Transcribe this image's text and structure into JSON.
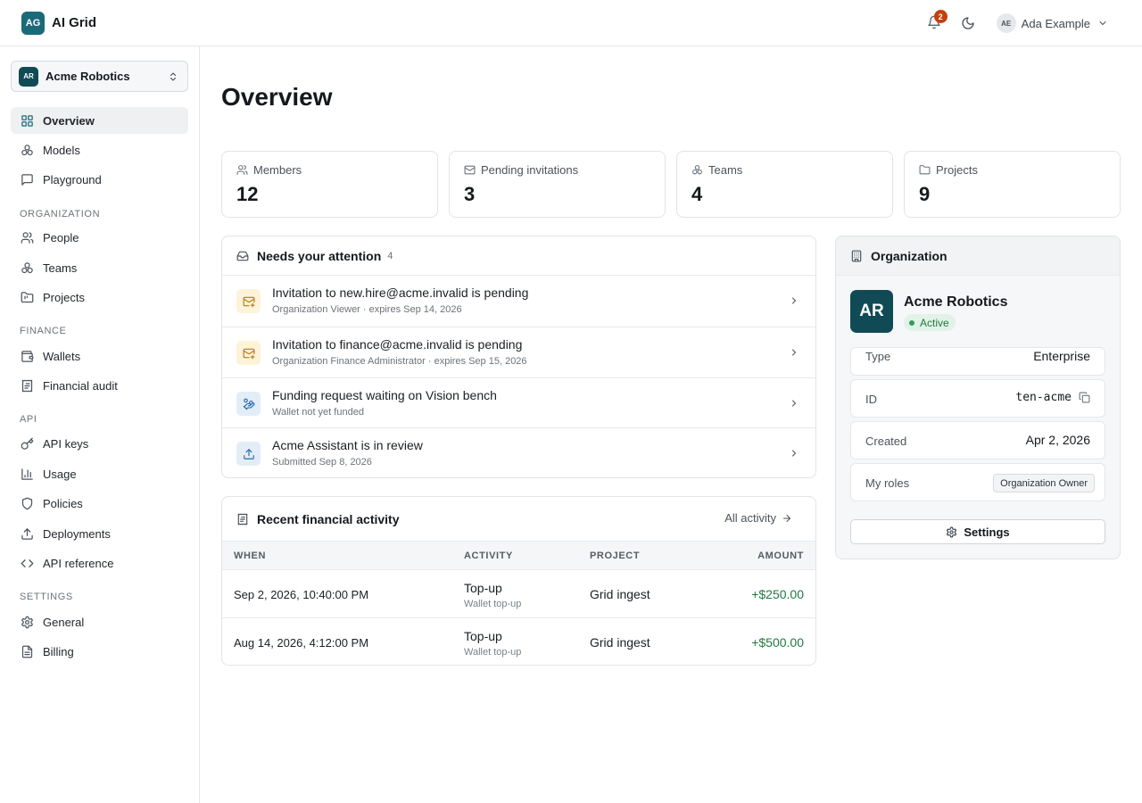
{
  "app": {
    "logo": "AG",
    "name": "AI Grid"
  },
  "header": {
    "notifications_count": "2",
    "user_initials": "AE",
    "user_name": "Ada Example"
  },
  "sidebar": {
    "org": {
      "initials": "AR",
      "name": "Acme Robotics"
    },
    "items": [
      {
        "label": "Overview",
        "icon": "grid-icon"
      },
      {
        "label": "Models",
        "icon": "cubes-icon"
      },
      {
        "label": "Playground",
        "icon": "chat-icon"
      },
      {
        "label": "People",
        "icon": "users-icon"
      },
      {
        "label": "Teams",
        "icon": "cubes-icon"
      },
      {
        "label": "Projects",
        "icon": "folder-icon"
      },
      {
        "label": "Wallets",
        "icon": "wallet-icon"
      },
      {
        "label": "Financial audit",
        "icon": "receipt-icon"
      },
      {
        "label": "API keys",
        "icon": "key-icon"
      },
      {
        "label": "Usage",
        "icon": "bar-chart-icon"
      },
      {
        "label": "Policies",
        "icon": "shield-icon"
      },
      {
        "label": "Deployments",
        "icon": "upload-icon"
      },
      {
        "label": "API reference",
        "icon": "code-icon"
      },
      {
        "label": "General",
        "icon": "gear-icon"
      },
      {
        "label": "Billing",
        "icon": "document-icon"
      }
    ],
    "sections": {
      "organization": "ORGANIZATION",
      "finance": "FINANCE",
      "api": "API",
      "settings": "SETTINGS"
    }
  },
  "main": {
    "title": "Overview",
    "stats": [
      {
        "label": "Members",
        "value": "12",
        "icon": "users-icon"
      },
      {
        "label": "Pending invitations",
        "value": "3",
        "icon": "mail-icon"
      },
      {
        "label": "Teams",
        "value": "4",
        "icon": "cubes-icon"
      },
      {
        "label": "Projects",
        "value": "9",
        "icon": "folder-icon"
      }
    ],
    "attention": {
      "title": "Needs your attention",
      "count": "4",
      "items": [
        {
          "title": "Invitation to new.hire@acme.invalid is pending",
          "subtitle": "Organization Viewer · expires Sep 14, 2026",
          "icon": "mail-plus-icon",
          "tone": "#fdf3d9"
        },
        {
          "title": "Invitation to finance@acme.invalid is pending",
          "subtitle": "Organization Finance Administrator · expires Sep 15, 2026",
          "icon": "mail-plus-icon",
          "tone": "#fdf3d9"
        },
        {
          "title": "Funding request waiting on Vision bench",
          "subtitle": "Wallet not yet funded",
          "icon": "hand-coins-icon",
          "tone": "#e3edf8"
        },
        {
          "title": "Acme Assistant is in review",
          "subtitle": "Submitted Sep 8, 2026",
          "icon": "upload-icon",
          "tone": "#e3edf8"
        }
      ]
    },
    "financial": {
      "title": "Recent financial activity",
      "all_link": "All activity",
      "columns": [
        "WHEN",
        "ACTIVITY",
        "PROJECT",
        "AMOUNT"
      ],
      "rows": [
        {
          "when": "Sep 2, 2026, 10:40:00 PM",
          "activity": "Top-up",
          "activity_sub": "Wallet top-up",
          "project": "Grid ingest",
          "amount": "+$250.00"
        },
        {
          "when": "Aug 14, 2026, 4:12:00 PM",
          "activity": "Top-up",
          "activity_sub": "Wallet top-up",
          "project": "Grid ingest",
          "amount": "+$500.00"
        }
      ]
    },
    "organization": {
      "title": "Organization",
      "initials": "AR",
      "name": "Acme Robotics",
      "status": "Active",
      "type_label": "Type",
      "type_value": "Enterprise",
      "id_label": "ID",
      "id_value": "ten-acme",
      "created_label": "Created",
      "created_value": "Apr 2, 2026",
      "roles_label": "My roles",
      "roles_value": "Organization Owner",
      "settings_label": "Settings"
    }
  },
  "colors": {
    "brand": "#1b6a78",
    "org_avatar": "#0f4a55",
    "positive": "#1f7a3f",
    "badge": "#c2410c"
  }
}
